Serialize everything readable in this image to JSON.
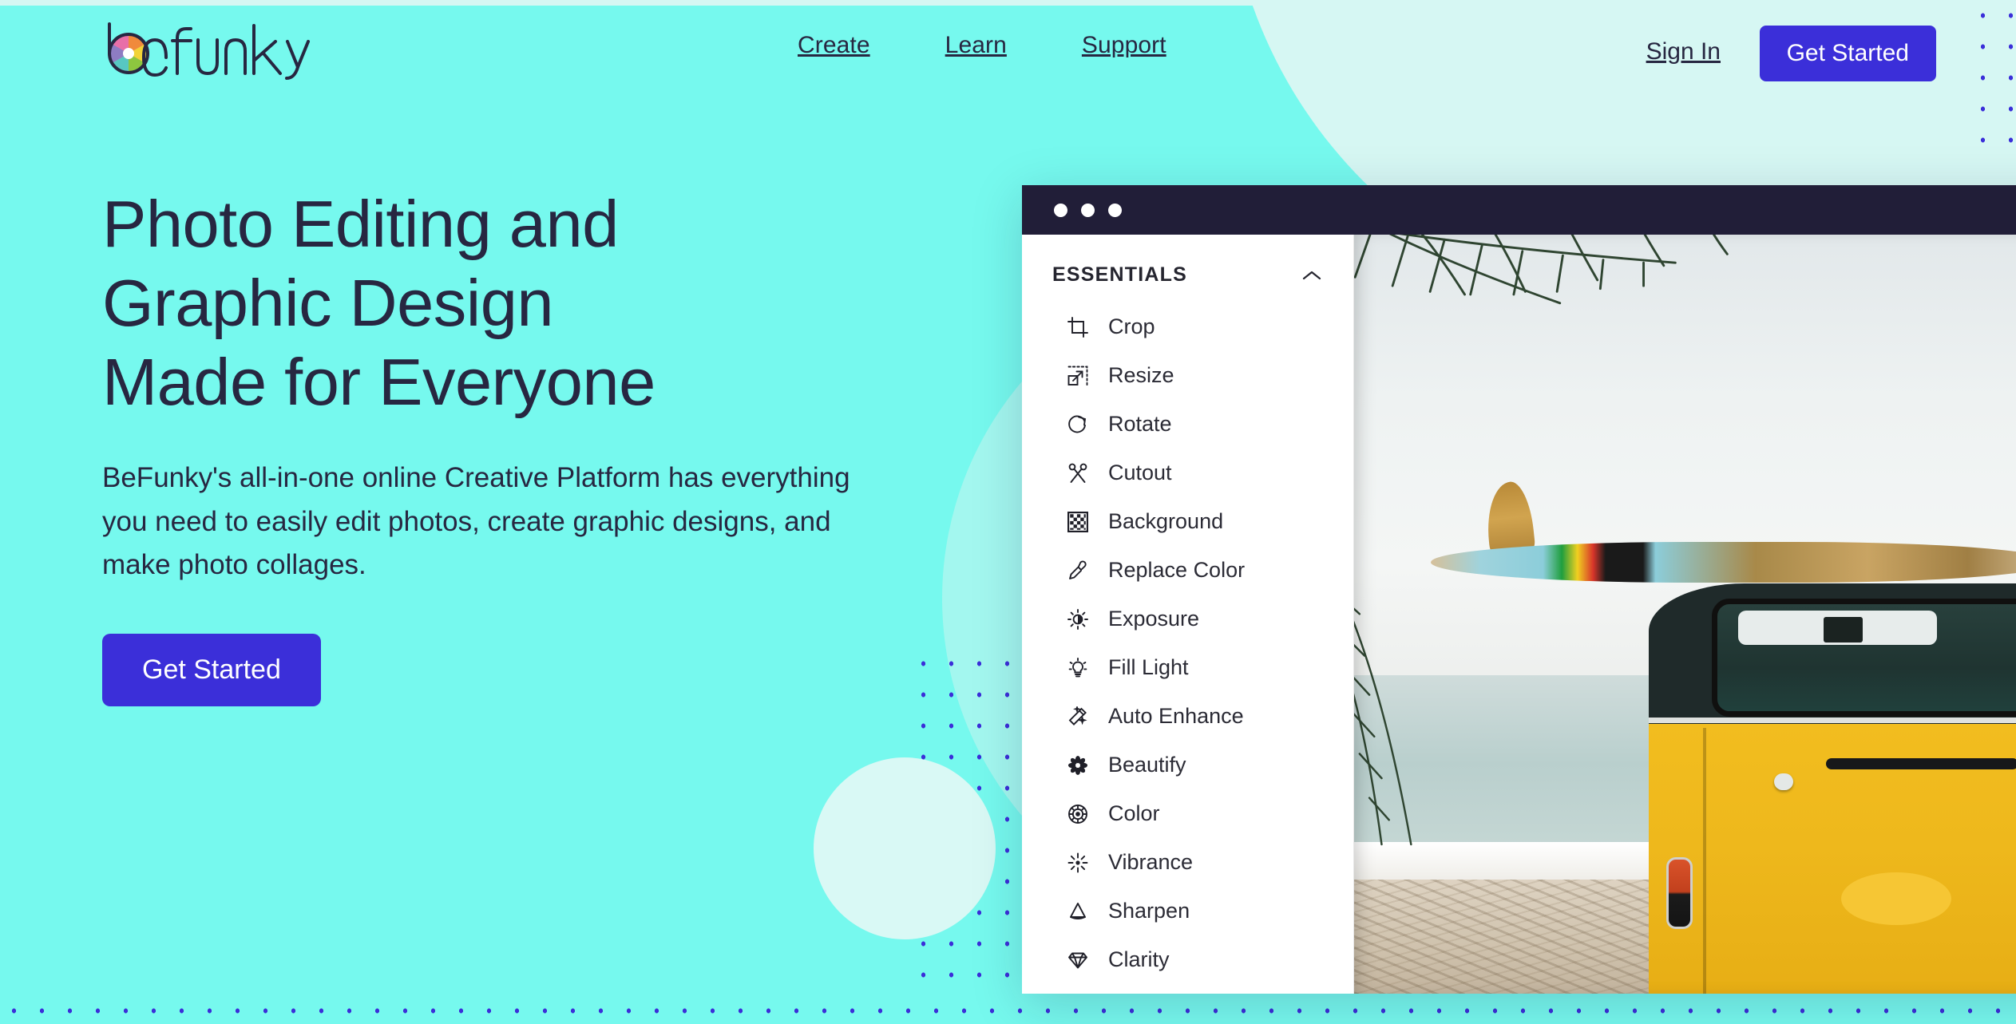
{
  "brand": {
    "name": "befunky",
    "logo_icon": "aperture-icon",
    "aperture_colors": [
      "#E86FA8",
      "#F08A3C",
      "#F2D336",
      "#8DC63F",
      "#57C7C2",
      "#8E7CC3"
    ]
  },
  "colors": {
    "background": "#76F9EE",
    "background_pale": "#D6F7F3",
    "accent": "#3B2FD9",
    "text_dark": "#272741",
    "titlebar": "#211E38",
    "dot": "#3B2FD9",
    "circle_mint": "#D9F9F5"
  },
  "header": {
    "nav": [
      {
        "label": "Create"
      },
      {
        "label": "Learn"
      },
      {
        "label": "Support"
      }
    ],
    "sign_in_label": "Sign In",
    "get_started_label": "Get Started"
  },
  "hero": {
    "headline_line1": "Photo Editing and",
    "headline_line2": "Graphic Design",
    "headline_line3": "Made for Everyone",
    "subtitle": "BeFunky's all-in-one online Creative Platform has everything you need to easily edit photos, create graphic designs, and make photo collages.",
    "cta_label": "Get Started"
  },
  "app": {
    "window_dots": [
      "dot",
      "dot",
      "dot"
    ],
    "panel": {
      "title": "ESSENTIALS",
      "collapse_icon": "chevron-up-icon",
      "tools": [
        {
          "label": "Crop",
          "icon": "crop-icon"
        },
        {
          "label": "Resize",
          "icon": "resize-icon"
        },
        {
          "label": "Rotate",
          "icon": "rotate-icon"
        },
        {
          "label": "Cutout",
          "icon": "scissors-icon"
        },
        {
          "label": "Background",
          "icon": "checkerboard-icon"
        },
        {
          "label": "Replace Color",
          "icon": "eyedropper-icon"
        },
        {
          "label": "Exposure",
          "icon": "brightness-icon"
        },
        {
          "label": "Fill Light",
          "icon": "lightbulb-icon"
        },
        {
          "label": "Auto Enhance",
          "icon": "magic-wand-icon"
        },
        {
          "label": "Beautify",
          "icon": "flower-icon"
        },
        {
          "label": "Color",
          "icon": "color-wheel-icon"
        },
        {
          "label": "Vibrance",
          "icon": "sunburst-icon"
        },
        {
          "label": "Sharpen",
          "icon": "cone-icon"
        },
        {
          "label": "Clarity",
          "icon": "diamond-icon"
        }
      ]
    },
    "canvas_photo_alt": "Yellow VW van with surfboard on roof at the beach"
  }
}
